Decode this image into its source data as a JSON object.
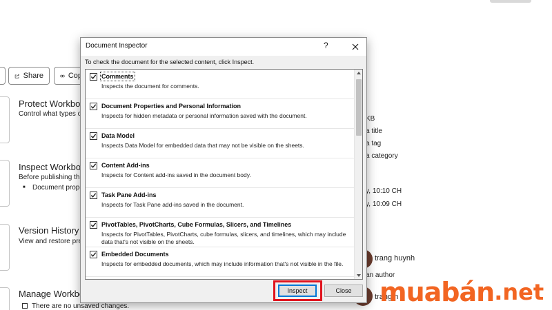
{
  "background": {
    "share_label": "Share",
    "copy_label": "Cop",
    "sections": [
      {
        "heading": "Protect Workboo",
        "sub": "Control what types of",
        "bullet": ""
      },
      {
        "heading": "Inspect Workboo",
        "sub": "Before publishing this",
        "bullet": "Document prope"
      },
      {
        "heading": "Version History",
        "sub": "View and restore previ",
        "bullet": ""
      },
      {
        "heading": "Manage Workboo",
        "sub": "There are no unsaved changes.",
        "bullet": ""
      }
    ],
    "properties": {
      "size": "KB",
      "title": "a title",
      "tags": "a tag",
      "category": "a category",
      "last_modified": "y, 10:10 CH",
      "created": "y, 10:09 CH",
      "author": "trang huynh",
      "add_author": "an author",
      "last_modified_by": "trang h"
    }
  },
  "dialog": {
    "title": "Document Inspector",
    "help": "?",
    "instruction": "To check the document for the selected content, click Inspect.",
    "items": [
      {
        "name": "Comments",
        "desc": "Inspects the document for comments.",
        "checked": true
      },
      {
        "name": "Document Properties and Personal Information",
        "desc": "Inspects for hidden metadata or personal information saved with the document.",
        "checked": true
      },
      {
        "name": "Data Model",
        "desc": "Inspects Data Model for embedded data that may not be visible on the sheets.",
        "checked": true
      },
      {
        "name": "Content Add-ins",
        "desc": "Inspects for Content add-ins saved in the document body.",
        "checked": true
      },
      {
        "name": "Task Pane Add-ins",
        "desc": "Inspects for Task Pane add-ins saved in the document.",
        "checked": true
      },
      {
        "name": "PivotTables, PivotCharts, Cube Formulas, Slicers, and Timelines",
        "desc": "Inspects for PivotTables, PivotCharts, cube formulas, slicers, and timelines, which may include data that's not visible on the sheets.",
        "checked": true
      },
      {
        "name": "Embedded Documents",
        "desc": "Inspects for embedded documents, which may include information that's not visible in the file.",
        "checked": true
      }
    ],
    "inspect_label": "Inspect",
    "close_label": "Close"
  },
  "watermark": {
    "main": "muabán",
    "tld": ".net"
  },
  "colors": {
    "highlight": "#e0141e",
    "watermark": "#f26522",
    "accent": "#0078d7"
  }
}
